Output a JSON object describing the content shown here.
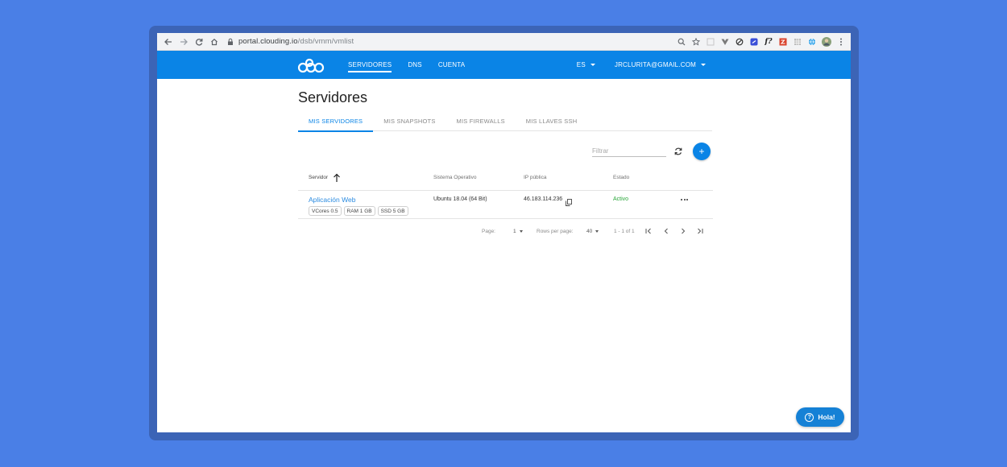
{
  "browser": {
    "url_host": "portal.clouding.io",
    "url_path": "/dsb/vmm/vmlist"
  },
  "colors": {
    "background": "#4a7fe6",
    "appbar": "#0a84e6",
    "accent": "#0a84e6",
    "status_active": "#2aa63a",
    "link": "#2b8be0"
  },
  "appbar": {
    "nav": [
      "SERVIDORES",
      "DNS",
      "CUENTA"
    ],
    "language": "ES",
    "user": "JRCLURITA@GMAIL.COM"
  },
  "page": {
    "title": "Servidores",
    "tabs": [
      "MIS SERVIDORES",
      "MIS SNAPSHOTS",
      "MIS FIREWALLS",
      "MIS LLAVES SSH"
    ],
    "filter_placeholder": "Filtrar"
  },
  "table": {
    "headers": [
      "Servidor",
      "Sistema Operativo",
      "IP pública",
      "Estado"
    ],
    "rows": [
      {
        "name": "Aplicación Web",
        "os": "Ubuntu 18.04 (64 Bit)",
        "ip": "46.183.114.236",
        "status": "Activo",
        "chips": [
          "VCores 0.5",
          "RAM 1 GB",
          "SSD 5 GB"
        ]
      }
    ]
  },
  "pagination": {
    "page_label": "Page:",
    "page_value": "1",
    "rows_label": "Rows per page:",
    "rows_value": "40",
    "range": "1 - 1 of 1"
  },
  "chat": {
    "label": "Hola!"
  },
  "icons": [
    "back-icon",
    "forward-icon",
    "reload-icon",
    "home-icon",
    "lock-icon",
    "zoom-icon",
    "star-icon",
    "refresh-icon",
    "plus-icon",
    "sort-up-icon",
    "copy-icon",
    "more-icon",
    "first-page-icon",
    "prev-page-icon",
    "next-page-icon",
    "last-page-icon",
    "help-icon"
  ]
}
